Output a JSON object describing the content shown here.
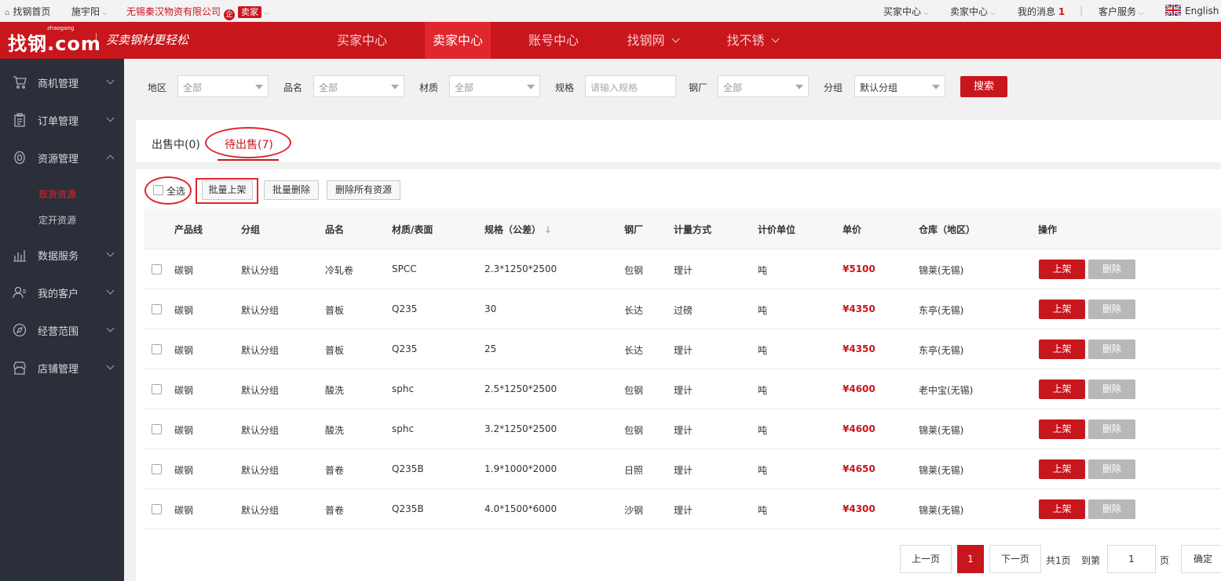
{
  "topbar": {
    "home": "找钢首页",
    "user": "施宇阳",
    "company": "无锡秦汉物资有限公司",
    "company_badge": "企",
    "seller_badge": "卖家",
    "buyer_center": "买家中心",
    "seller_center": "卖家中心",
    "messages": "我的消息",
    "messages_count": "1",
    "service": "客户服务",
    "language": "English"
  },
  "header": {
    "logo": "找钢.com",
    "logo_sub": "zhaogang",
    "slogan": "买卖钢材更轻松",
    "nav": [
      "买家中心",
      "卖家中心",
      "账号中心",
      "找钢网",
      "找不锈"
    ]
  },
  "sidebar": {
    "items": [
      "商机管理",
      "订单管理",
      "资源管理",
      "数据服务",
      "我的客户",
      "经营范围",
      "店铺管理"
    ],
    "sub_items": [
      "现货资源",
      "定开资源"
    ]
  },
  "filter": {
    "region_label": "地区",
    "region_value": "全部",
    "product_label": "品名",
    "product_value": "全部",
    "material_label": "材质",
    "material_value": "全部",
    "spec_label": "规格",
    "spec_placeholder": "请输入规格",
    "mill_label": "钢厂",
    "mill_value": "全部",
    "group_label": "分组",
    "group_value": "默认分组",
    "search_button": "搜索"
  },
  "tabs": [
    "出售中(0)",
    "待出售(7)"
  ],
  "actions": {
    "select_all": "全选",
    "batch_list": "批量上架",
    "batch_delete": "批量删除",
    "delete_all": "删除所有资源"
  },
  "table": {
    "headers": [
      "产品线",
      "分组",
      "品名",
      "材质/表面",
      "规格（公差）",
      "钢厂",
      "计量方式",
      "计价单位",
      "单价",
      "仓库（地区）",
      "操作"
    ],
    "list_button": "上架",
    "delete_button": "删除",
    "rows": [
      [
        "碳钢",
        "默认分组",
        "冷轧卷",
        "SPCC",
        "2.3*1250*2500",
        "包钢",
        "理计",
        "吨",
        "¥5100",
        "锦莱(无锡)"
      ],
      [
        "碳钢",
        "默认分组",
        "普板",
        "Q235",
        "30",
        "长达",
        "过磅",
        "吨",
        "¥4350",
        "东亭(无锡)"
      ],
      [
        "碳钢",
        "默认分组",
        "普板",
        "Q235",
        "25",
        "长达",
        "理计",
        "吨",
        "¥4350",
        "东亭(无锡)"
      ],
      [
        "碳钢",
        "默认分组",
        "酸洗",
        "sphc",
        "2.5*1250*2500",
        "包钢",
        "理计",
        "吨",
        "¥4600",
        "老中宝(无锡)"
      ],
      [
        "碳钢",
        "默认分组",
        "酸洗",
        "sphc",
        "3.2*1250*2500",
        "包钢",
        "理计",
        "吨",
        "¥4600",
        "锦莱(无锡)"
      ],
      [
        "碳钢",
        "默认分组",
        "普卷",
        "Q235B",
        "1.9*1000*2000",
        "日照",
        "理计",
        "吨",
        "¥4650",
        "锦莱(无锡)"
      ],
      [
        "碳钢",
        "默认分组",
        "普卷",
        "Q235B",
        "4.0*1500*6000",
        "沙钢",
        "理计",
        "吨",
        "¥4300",
        "锦莱(无锡)"
      ]
    ]
  },
  "pagination": {
    "prev": "上一页",
    "current": "1",
    "next": "下一页",
    "total": "共1页",
    "goto": "到第",
    "page_input": "1",
    "page_unit": "页",
    "confirm": "确定"
  }
}
